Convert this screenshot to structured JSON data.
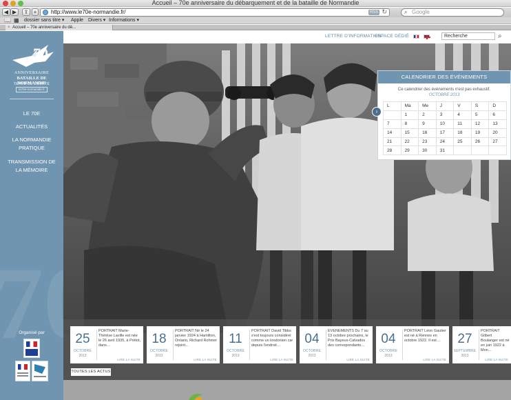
{
  "browser": {
    "window_title": "Accueil – 70e anniversaire du débarquement et de la bataille de Normandie",
    "url": "http://www.le70e-normandie.fr/",
    "rss_label": "RSS",
    "search_placeholder": "Google",
    "bookmarks": [
      "dossier sans titre ▾",
      "Apple",
      "Divers ▾",
      "Informations ▾"
    ],
    "tab_title": "Accueil – 70e anniversaire du dé..."
  },
  "site": {
    "logo": {
      "number": "70",
      "anniversaire": "ANNIVERSAIRE",
      "bataille": "BATAILLE DE NORMANDIE",
      "terre": "TERRE DE LIBERTÉ",
      "url": "le70e-normandie.fr"
    },
    "nav": [
      "LE 70E",
      "ACTUALITÉS",
      "LA NORMANDIE PRATIQUE",
      "TRANSMISSION DE LA MÉMOIRE"
    ],
    "organise_par": "Organisé par",
    "top_links": [
      "LETTRE D'INFORMATION",
      "ESPACE DÉDIÉ"
    ],
    "search_value": "Recherche"
  },
  "calendar": {
    "title": "CALENDRIER DES ÉVÉNEMENTS",
    "subtitle": "Ce calendrier des événements n'est pas exhaustif.",
    "month": "OCTOBRE 2013",
    "weekdays": [
      "L",
      "Ma",
      "Me",
      "J",
      "V",
      "S",
      "D"
    ],
    "weeks": [
      [
        "",
        "1",
        "2",
        "3",
        "4",
        "5",
        "6"
      ],
      [
        "7",
        "8",
        "9",
        "10",
        "11",
        "12",
        "13"
      ],
      [
        "14",
        "15",
        "16",
        "17",
        "18",
        "19",
        "20"
      ],
      [
        "21",
        "22",
        "23",
        "24",
        "25",
        "26",
        "27"
      ],
      [
        "28",
        "29",
        "30",
        "31",
        "",
        "",
        ""
      ]
    ]
  },
  "news": {
    "cards": [
      {
        "day": "25",
        "month": "OCTOBRE",
        "year": "2013",
        "text": "PORTRAIT Marie-Thérèse Laville est née le 26 avril 1935, à Prétot, dans…",
        "more": "LIRE LA SUITE"
      },
      {
        "day": "18",
        "month": "OCTOBRE",
        "year": "2013",
        "text": "PORTRAIT Né le 24 janvier 1924 à Hamilton, Ontario, Richard Rohmer rejoint…",
        "more": "LIRE LA SUITE"
      },
      {
        "day": "11",
        "month": "OCTOBRE",
        "year": "2013",
        "text": "PORTRAIT David Tibbs s'est toujours considéré comme un londonien car depuis l'endroit…",
        "more": "LIRE LA SUITE"
      },
      {
        "day": "04",
        "month": "OCTOBRE",
        "year": "2013",
        "text": "ÉVÉNEMENTS Du 7 au 13 octobre prochains, le Prix Bayeux-Calvados des correspondants…",
        "more": "LIRE LA SUITE"
      },
      {
        "day": "04",
        "month": "OCTOBRE",
        "year": "2013",
        "text": "PORTRAIT Léon Gautier est né à Rennes en octobre 1922. Il est…",
        "more": "LIRE LA SUITE"
      },
      {
        "day": "27",
        "month": "SEPTEMBRE",
        "year": "2013",
        "text": "PORTRAIT Gilbert Boulanger est né en juin 1922 à Mon…",
        "more": "LIRE LA SUITE"
      }
    ],
    "all_label": "TOUTES LES ACTUS"
  }
}
